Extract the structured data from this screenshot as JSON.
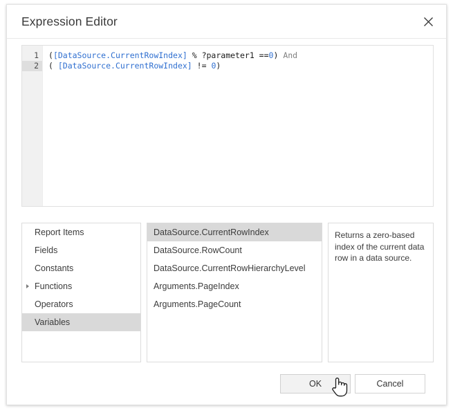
{
  "dialog": {
    "title": "Expression Editor",
    "close_icon": "close-icon"
  },
  "editor": {
    "lines": [
      {
        "number": "1",
        "active": false,
        "tokens": [
          {
            "text": "(",
            "type": "plain"
          },
          {
            "text": "[DataSource.CurrentRowIndex]",
            "type": "ref"
          },
          {
            "text": " % ?parameter1 ==",
            "type": "plain"
          },
          {
            "text": "0",
            "type": "num"
          },
          {
            "text": ")",
            "type": "plain"
          },
          {
            "text": " And",
            "type": "kw"
          }
        ]
      },
      {
        "number": "2",
        "active": true,
        "tokens": [
          {
            "text": "( ",
            "type": "plain"
          },
          {
            "text": "[DataSource.CurrentRowIndex]",
            "type": "ref"
          },
          {
            "text": " != ",
            "type": "plain"
          },
          {
            "text": "0",
            "type": "num"
          },
          {
            "text": ")",
            "type": "plain"
          }
        ]
      }
    ],
    "full_text_line1": "([DataSource.CurrentRowIndex] % ?parameter1 ==0) And",
    "full_text_line2": "( [DataSource.CurrentRowIndex] != 0)"
  },
  "categories": {
    "items": [
      {
        "label": "Report Items",
        "selected": false,
        "expandable": false
      },
      {
        "label": "Fields",
        "selected": false,
        "expandable": false
      },
      {
        "label": "Constants",
        "selected": false,
        "expandable": false
      },
      {
        "label": "Functions",
        "selected": false,
        "expandable": true
      },
      {
        "label": "Operators",
        "selected": false,
        "expandable": false
      },
      {
        "label": "Variables",
        "selected": true,
        "expandable": false
      }
    ]
  },
  "members": {
    "items": [
      {
        "label": "DataSource.CurrentRowIndex",
        "selected": true
      },
      {
        "label": "DataSource.RowCount",
        "selected": false
      },
      {
        "label": "DataSource.CurrentRowHierarchyLevel",
        "selected": false
      },
      {
        "label": "Arguments.PageIndex",
        "selected": false
      },
      {
        "label": "Arguments.PageCount",
        "selected": false
      }
    ]
  },
  "description": {
    "text": "Returns a zero-based index of the current data row in a data source."
  },
  "footer": {
    "ok_label": "OK",
    "cancel_label": "Cancel"
  },
  "colors": {
    "reference": "#2f6fd0",
    "number": "#2f6fd0",
    "keyword": "#808080",
    "selection": "#d9d9d9",
    "gutter": "#f1f1f1",
    "gutter_active": "#dedede"
  }
}
